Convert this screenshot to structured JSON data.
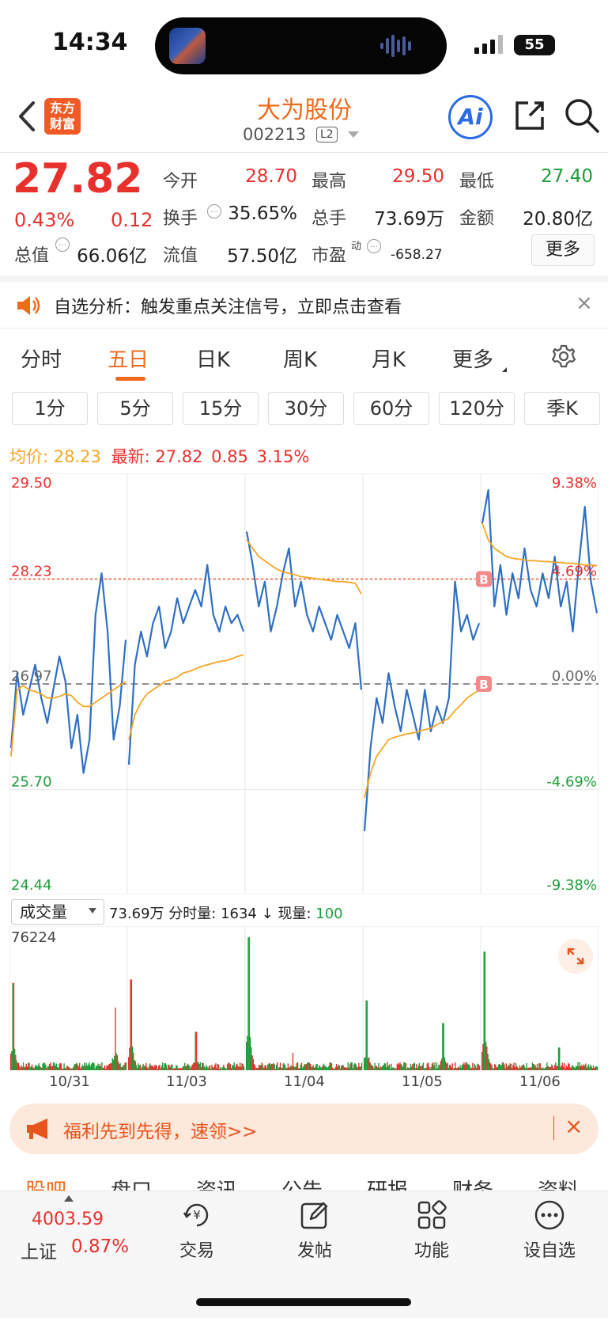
{
  "status_bar": {
    "time": "14:34",
    "battery": "55"
  },
  "header": {
    "logo_line1": "东方",
    "logo_line2": "财富",
    "stock_name": "大为股份",
    "stock_code": "002213",
    "level_badge": "L2",
    "ai_label": "Ai"
  },
  "quote": {
    "price": "27.82",
    "change_pct": "0.43%",
    "change_abs": "0.12",
    "fields": [
      {
        "label": "今开",
        "value": "28.70",
        "color": "#e8302c"
      },
      {
        "label": "最高",
        "value": "29.50",
        "color": "#e8302c"
      },
      {
        "label": "最低",
        "value": "27.40",
        "color": "#1f9d3a"
      },
      {
        "label": "换手",
        "value": "35.65%",
        "color": "#222222"
      },
      {
        "label": "总手",
        "value": "73.69万",
        "color": "#222222"
      },
      {
        "label": "金额",
        "value": "20.80亿",
        "color": "#222222"
      },
      {
        "label": "总值",
        "value": "66.06亿",
        "color": "#222222"
      },
      {
        "label": "流值",
        "value": "57.50亿",
        "color": "#222222"
      },
      {
        "label": "市盈",
        "label_sup": "动",
        "value": "-658.27",
        "color": "#222222"
      }
    ],
    "more_label": "更多"
  },
  "notice": {
    "text": "自选分析：触发重点关注信号，立即点击查看",
    "close": "×"
  },
  "period_tabs": [
    "分时",
    "五日",
    "日K",
    "周K",
    "月K",
    "更多"
  ],
  "active_period": "五日",
  "interval_tabs": [
    "1分",
    "5分",
    "15分",
    "30分",
    "60分",
    "120分",
    "季K"
  ],
  "chart_header": {
    "avg_label": "均价:",
    "avg_value": "28.23",
    "latest_label": "最新:",
    "latest_value": "27.82",
    "latest_change": "0.85",
    "latest_pct": "3.15%"
  },
  "chart_data": {
    "type": "line",
    "title": "",
    "y_ticks_left": [
      "29.50",
      "28.23",
      "26.97",
      "25.70",
      "24.44"
    ],
    "y_ticks_right": [
      "9.38%",
      "4.69%",
      "0.00%",
      "-4.69%",
      "-9.38%"
    ],
    "ylim": [
      24.44,
      29.5
    ],
    "prev_close": 26.97,
    "avg_price_ref": 28.23,
    "x_dates": [
      "10/31",
      "11/03",
      "11/04",
      "11/05",
      "11/06"
    ],
    "series": [
      {
        "name": "价格",
        "color": "#2f6fc4",
        "days": [
          [
            26.2,
            27.1,
            26.6,
            26.9,
            27.2,
            26.8,
            26.5,
            26.9,
            27.3,
            27.0,
            26.2,
            26.6,
            25.9,
            26.3,
            27.8,
            28.3,
            27.6,
            26.3,
            26.7,
            27.5
          ],
          [
            26.0,
            27.2,
            27.6,
            27.3,
            27.7,
            27.9,
            27.4,
            27.6,
            28.0,
            27.7,
            27.9,
            28.1,
            27.9,
            28.4,
            27.8,
            27.6,
            27.9,
            27.7,
            27.8,
            27.6
          ],
          [
            28.8,
            28.4,
            27.9,
            28.2,
            27.6,
            27.9,
            28.3,
            28.6,
            27.9,
            28.2,
            27.8,
            27.6,
            27.9,
            27.7,
            27.5,
            27.8,
            27.6,
            27.4,
            27.7,
            26.9
          ],
          [
            25.2,
            26.2,
            26.8,
            26.5,
            27.1,
            26.7,
            26.4,
            26.9,
            26.6,
            26.3,
            26.9,
            26.4,
            26.7,
            26.5,
            26.8,
            28.2,
            27.6,
            27.8,
            27.5,
            27.7
          ],
          [
            28.9,
            29.3,
            27.9,
            28.4,
            27.8,
            28.3,
            28.0,
            28.6,
            28.1,
            27.9,
            28.3,
            28.0,
            28.5,
            27.9,
            28.2,
            27.6,
            28.4,
            29.1,
            28.2,
            27.82
          ]
        ]
      },
      {
        "name": "均价",
        "color": "#f5a623",
        "days": [
          [
            26.1,
            26.9,
            26.95,
            26.9,
            26.88,
            26.85,
            26.8,
            26.8,
            26.82,
            26.85,
            26.83,
            26.75,
            26.7,
            26.7,
            26.75,
            26.8,
            26.85,
            26.9,
            26.95,
            27.0
          ],
          [
            26.3,
            26.6,
            26.75,
            26.85,
            26.9,
            26.95,
            27.0,
            27.02,
            27.05,
            27.1,
            27.12,
            27.15,
            27.18,
            27.2,
            27.22,
            27.24,
            27.25,
            27.27,
            27.3,
            27.32
          ],
          [
            28.7,
            28.6,
            28.5,
            28.45,
            28.4,
            28.35,
            28.32,
            28.3,
            28.28,
            28.26,
            28.25,
            28.24,
            28.23,
            28.22,
            28.21,
            28.2,
            28.2,
            28.19,
            28.18,
            28.05
          ],
          [
            25.6,
            25.9,
            26.1,
            26.2,
            26.3,
            26.33,
            26.35,
            26.37,
            26.38,
            26.4,
            26.42,
            26.44,
            26.48,
            26.52,
            26.56,
            26.65,
            26.72,
            26.8,
            26.85,
            26.9
          ],
          [
            28.9,
            28.7,
            28.6,
            28.55,
            28.5,
            28.48,
            28.47,
            28.46,
            28.45,
            28.45,
            28.44,
            28.44,
            28.43,
            28.43,
            28.42,
            28.42,
            28.41,
            28.4,
            28.4,
            28.39
          ]
        ]
      }
    ],
    "markers": [
      {
        "label": "B",
        "day": 4,
        "value": 28.23
      },
      {
        "label": "B",
        "day": 4,
        "value": 26.97
      }
    ]
  },
  "volume": {
    "selector_label": "成交量",
    "total": "73.69万",
    "period_label": "分时量:",
    "period_value": "1634",
    "arrow": "↓",
    "current_label": "现量:",
    "current_value": "100",
    "max_label": "76224",
    "max": 76224,
    "peaks": [
      {
        "day": 0,
        "pos": 0.02,
        "value": 50000
      },
      {
        "day": 0,
        "pos": 0.9,
        "value": 36000
      },
      {
        "day": 1,
        "pos": 0.02,
        "value": 52000
      },
      {
        "day": 1,
        "pos": 0.58,
        "value": 22000
      },
      {
        "day": 2,
        "pos": 0.02,
        "value": 76224
      },
      {
        "day": 2,
        "pos": 0.4,
        "value": 10000
      },
      {
        "day": 3,
        "pos": 0.02,
        "value": 40000
      },
      {
        "day": 3,
        "pos": 0.68,
        "value": 27000
      },
      {
        "day": 4,
        "pos": 0.02,
        "value": 68000
      },
      {
        "day": 4,
        "pos": 0.66,
        "value": 13000
      }
    ]
  },
  "promo": {
    "text": "福利先到先得，速领>>",
    "close": "×"
  },
  "section_tabs": [
    "股吧",
    "盘口",
    "资讯",
    "公告",
    "研报",
    "财务",
    "资料"
  ],
  "bottom_nav": {
    "index_value": "4003.59",
    "index_name": "上证",
    "index_pct": "0.87%",
    "items": [
      "交易",
      "发帖",
      "功能",
      "设自选"
    ]
  }
}
